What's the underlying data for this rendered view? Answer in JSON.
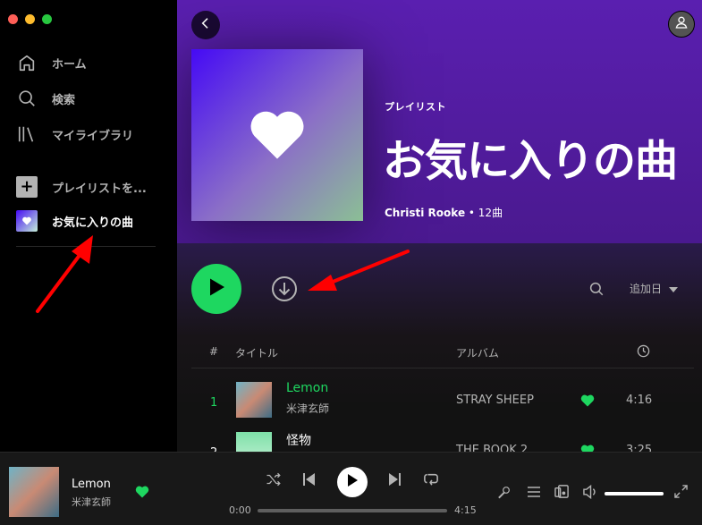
{
  "sidebar": {
    "nav": [
      {
        "label": "ホーム",
        "icon": "home-icon"
      },
      {
        "label": "検索",
        "icon": "search-icon"
      },
      {
        "label": "マイライブラリ",
        "icon": "library-icon"
      }
    ],
    "create_playlist": "プレイリストを...",
    "liked_songs": "お気に入りの曲"
  },
  "header": {
    "type": "プレイリスト",
    "title": "お気に入りの曲",
    "owner": "Christi Rooke",
    "track_count": "• 12曲"
  },
  "actions": {
    "sort_label": "追加日"
  },
  "table": {
    "columns": {
      "num": "#",
      "title": "タイトル",
      "album": "アルバム"
    },
    "rows": [
      {
        "num": "1",
        "title": "Lemon",
        "artist": "米津玄師",
        "album": "STRAY SHEEP",
        "duration": "4:16"
      },
      {
        "num": "2",
        "title": "怪物",
        "artist": "",
        "album": "THE BOOK 2",
        "duration": "3:25"
      }
    ]
  },
  "player": {
    "title": "Lemon",
    "artist": "米津玄師",
    "time_current": "0:00",
    "time_total": "4:15",
    "progress": 0,
    "volume": 1.0
  },
  "colors": {
    "accent": "#1ed760",
    "hero": "#5a1fb0",
    "annotation": "#ff0000"
  }
}
